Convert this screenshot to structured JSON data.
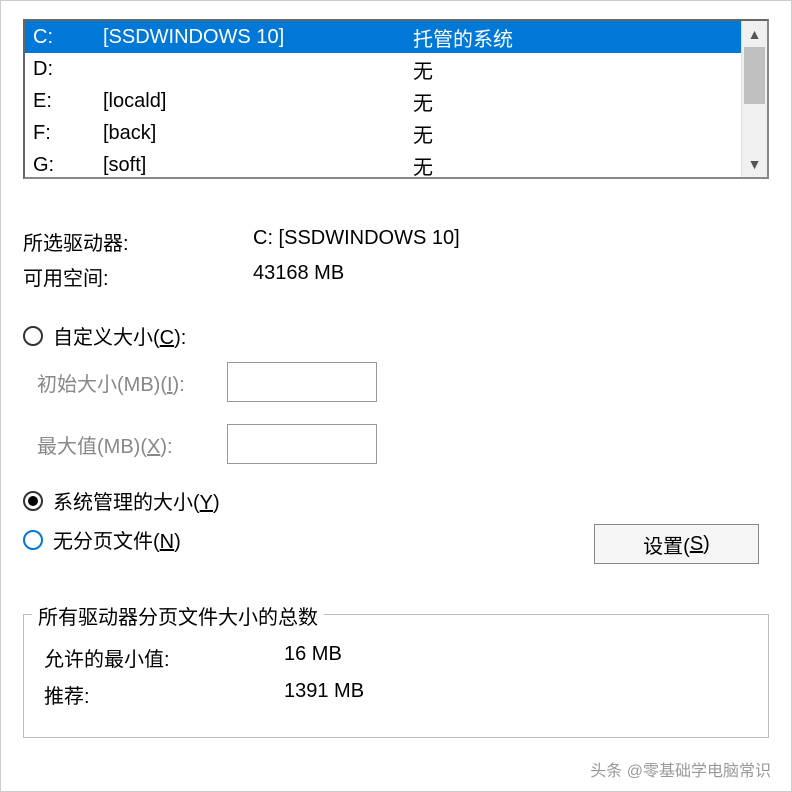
{
  "drives": [
    {
      "letter": "C:",
      "volume": "[SSDWINDOWS 10]",
      "status": "托管的系统",
      "selected": true
    },
    {
      "letter": "D:",
      "volume": "",
      "status": "无",
      "selected": false
    },
    {
      "letter": "E:",
      "volume": "[locald]",
      "status": "无",
      "selected": false
    },
    {
      "letter": "F:",
      "volume": "[back]",
      "status": "无",
      "selected": false
    },
    {
      "letter": "G:",
      "volume": "[soft]",
      "status": "无",
      "selected": false
    }
  ],
  "scroll_up_glyph": "▲",
  "scroll_down_glyph": "▼",
  "selected_drive": {
    "label": "所选驱动器:",
    "value": "C:  [SSDWINDOWS 10]"
  },
  "free_space": {
    "label": "可用空间:",
    "value": "43168 MB"
  },
  "custom_size": {
    "label_prefix": "自定义大小(",
    "label_key": "C",
    "label_suffix": "):"
  },
  "initial_size": {
    "label_prefix": "初始大小(MB)(",
    "label_key": "I",
    "label_suffix": "):",
    "value": ""
  },
  "max_size": {
    "label_prefix": "最大值(MB)(",
    "label_key": "X",
    "label_suffix": "):",
    "value": ""
  },
  "system_managed": {
    "label_prefix": "系统管理的大小(",
    "label_key": "Y",
    "label_suffix": ")"
  },
  "no_paging": {
    "label_prefix": "无分页文件(",
    "label_key": "N",
    "label_suffix": ")"
  },
  "set_button": {
    "label_prefix": "设置(",
    "label_key": "S",
    "label_suffix": ")"
  },
  "totals": {
    "title": "所有驱动器分页文件大小的总数",
    "min": {
      "label": "允许的最小值:",
      "value": "16 MB"
    },
    "recommended": {
      "label": "推荐:",
      "value": "1391 MB"
    }
  },
  "watermark": "头条 @零基础学电脑常识"
}
